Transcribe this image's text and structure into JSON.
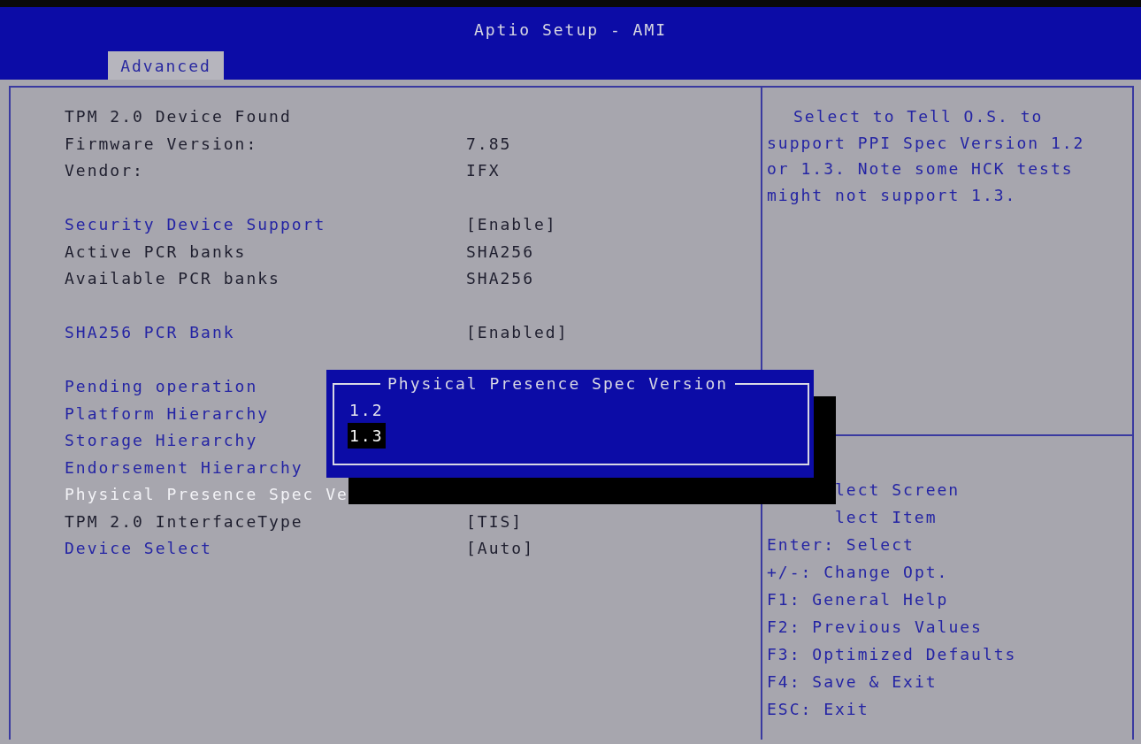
{
  "window": {
    "title": "Aptio Setup - AMI"
  },
  "tabs": [
    {
      "label": "Advanced",
      "selected": true
    }
  ],
  "groups": [
    [
      {
        "kind": "info",
        "label": "TPM 2.0 Device Found",
        "selected": false
      },
      {
        "kind": "info",
        "label": "Firmware Version:",
        "value": "7.85",
        "selected": false
      },
      {
        "kind": "info",
        "label": "Vendor:",
        "value": "IFX",
        "selected": false
      }
    ],
    [
      {
        "kind": "setting",
        "label": "Security Device Support",
        "value": "[Enable]",
        "selected": false
      },
      {
        "kind": "info",
        "label": "Active PCR banks",
        "value": "SHA256",
        "selected": false
      },
      {
        "kind": "info",
        "label": "Available PCR banks",
        "value": "SHA256",
        "selected": false
      }
    ],
    [
      {
        "kind": "setting",
        "label": "SHA256 PCR Bank",
        "value": "[Enabled]",
        "selected": false
      }
    ],
    [
      {
        "kind": "setting",
        "label": "Pending operation",
        "selected": false
      },
      {
        "kind": "setting",
        "label": "Platform Hierarchy",
        "selected": false
      },
      {
        "kind": "setting",
        "label": "Storage Hierarchy",
        "selected": false
      },
      {
        "kind": "setting",
        "label": "Endorsement Hierarchy",
        "selected": false
      },
      {
        "kind": "setting",
        "label": "Physical Presence Spec Ve",
        "selected": true
      },
      {
        "kind": "info",
        "label": "TPM 2.0 InterfaceType",
        "value": "[TIS]",
        "selected": false
      },
      {
        "kind": "setting",
        "label": "Device Select",
        "value": "[Auto]",
        "selected": false
      }
    ]
  ],
  "help": {
    "description": "Select to Tell O.S. to support PPI Spec Version 1.2 or 1.3. Note some HCK tests might not support 1.3.",
    "keys": [
      {
        "kind": "clipped",
        "text": "lect Screen"
      },
      {
        "kind": "clipped",
        "text": "lect Item"
      },
      {
        "kind": "full",
        "text": "Enter: Select"
      },
      {
        "kind": "full",
        "text": "+/-: Change Opt."
      },
      {
        "kind": "full",
        "text": "F1: General Help"
      },
      {
        "kind": "full",
        "text": "F2: Previous Values"
      },
      {
        "kind": "full",
        "text": "F3: Optimized Defaults"
      },
      {
        "kind": "full",
        "text": "F4: Save & Exit"
      },
      {
        "kind": "full",
        "text": "ESC: Exit"
      }
    ]
  },
  "popup": {
    "title": "Physical Presence Spec Version",
    "options": [
      {
        "label": "1.2",
        "selected": false
      },
      {
        "label": "1.3",
        "selected": true
      }
    ]
  }
}
